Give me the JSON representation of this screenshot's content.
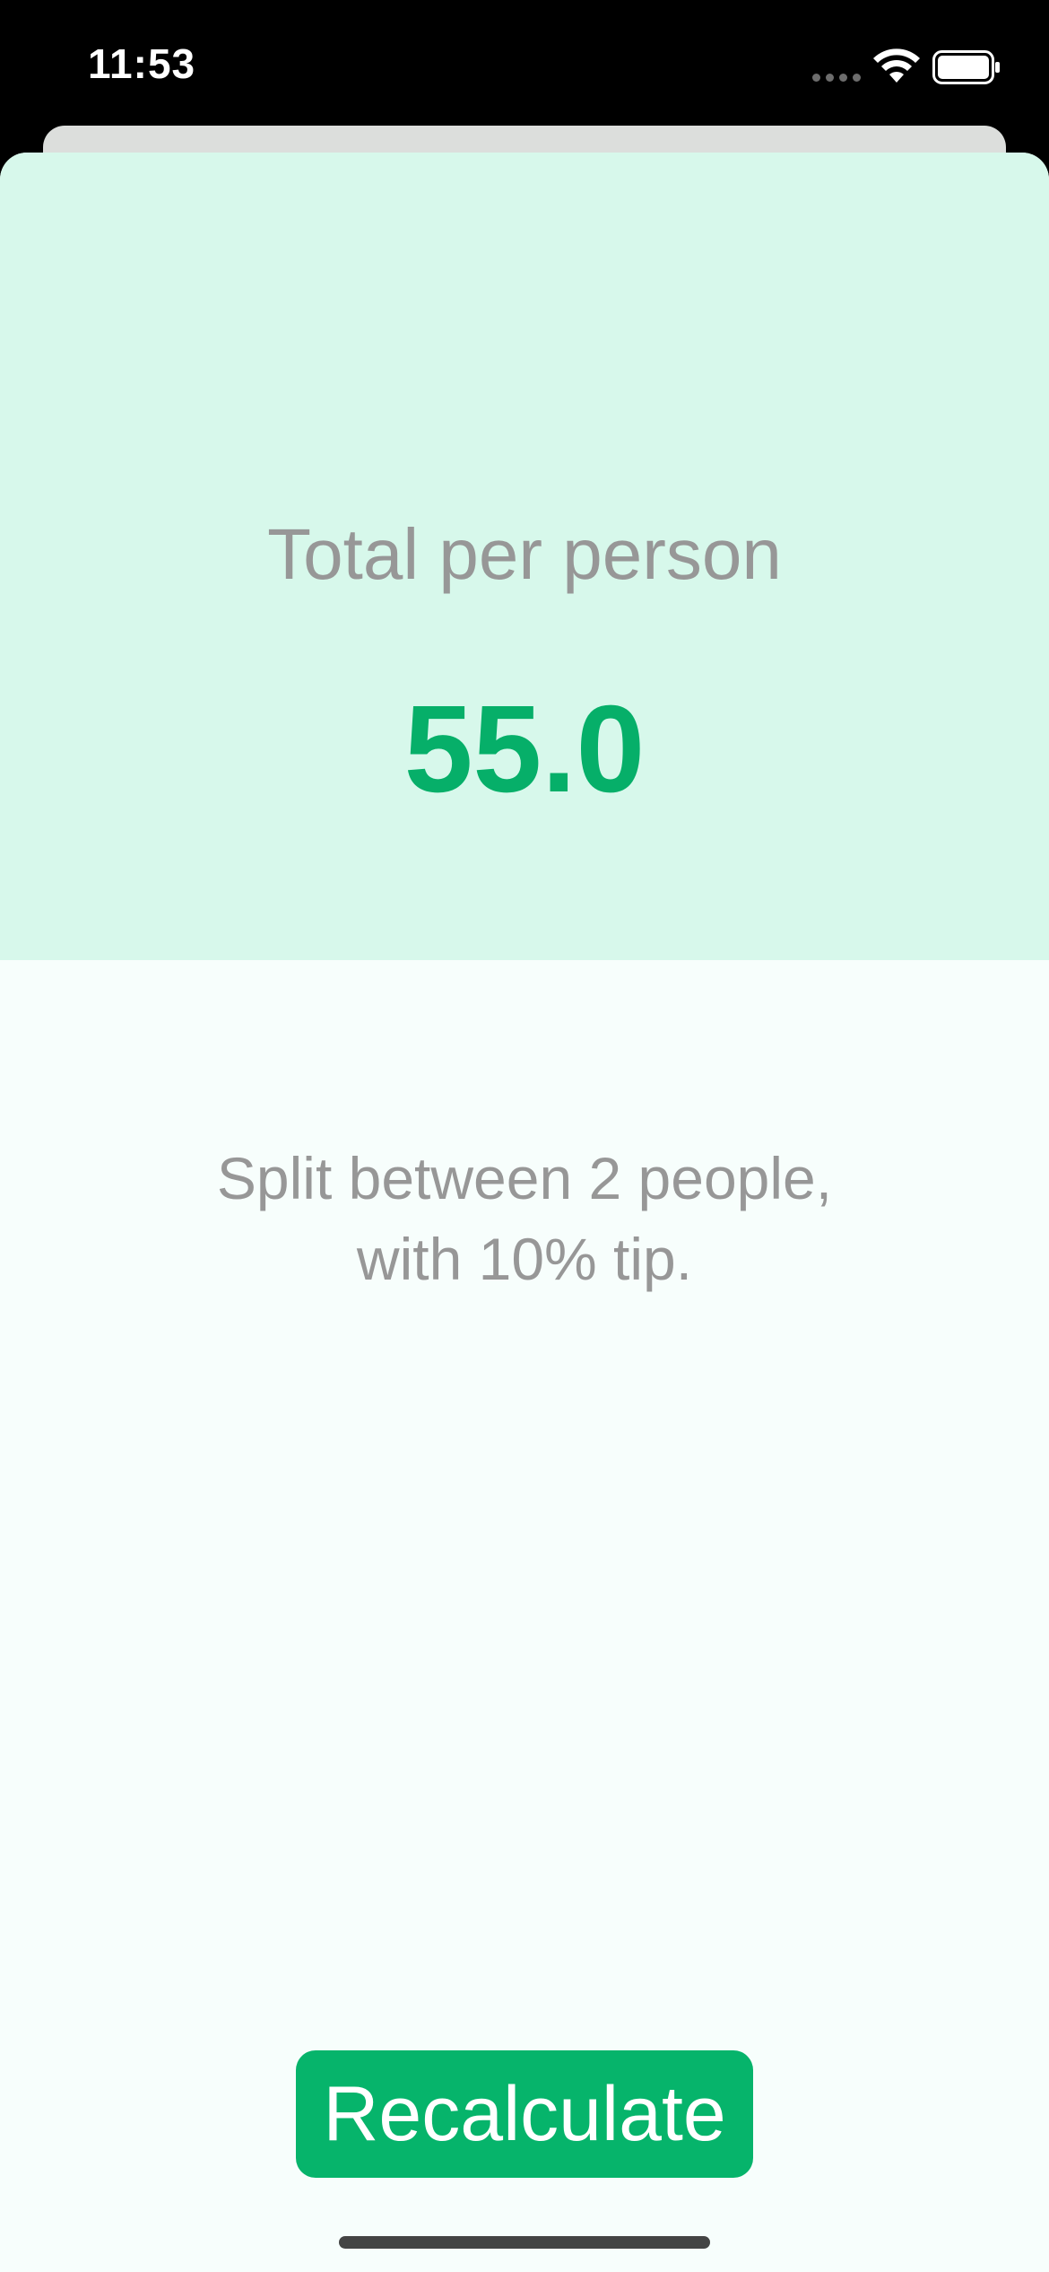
{
  "status_bar": {
    "time": "11:53",
    "icons": [
      "signal-dots-icon",
      "wifi-icon",
      "battery-icon"
    ]
  },
  "result": {
    "title": "Total per person",
    "value": "55.0"
  },
  "summary": {
    "line1": "Split between 2 people,",
    "line2": "with 10% tip."
  },
  "actions": {
    "recalculate_label": "Recalculate"
  },
  "colors": {
    "accent": "#06b46b",
    "result_value": "#06af69",
    "panel_background": "#d7f8eb",
    "card_background": "#f7fefc",
    "secondary_text": "#979797"
  }
}
